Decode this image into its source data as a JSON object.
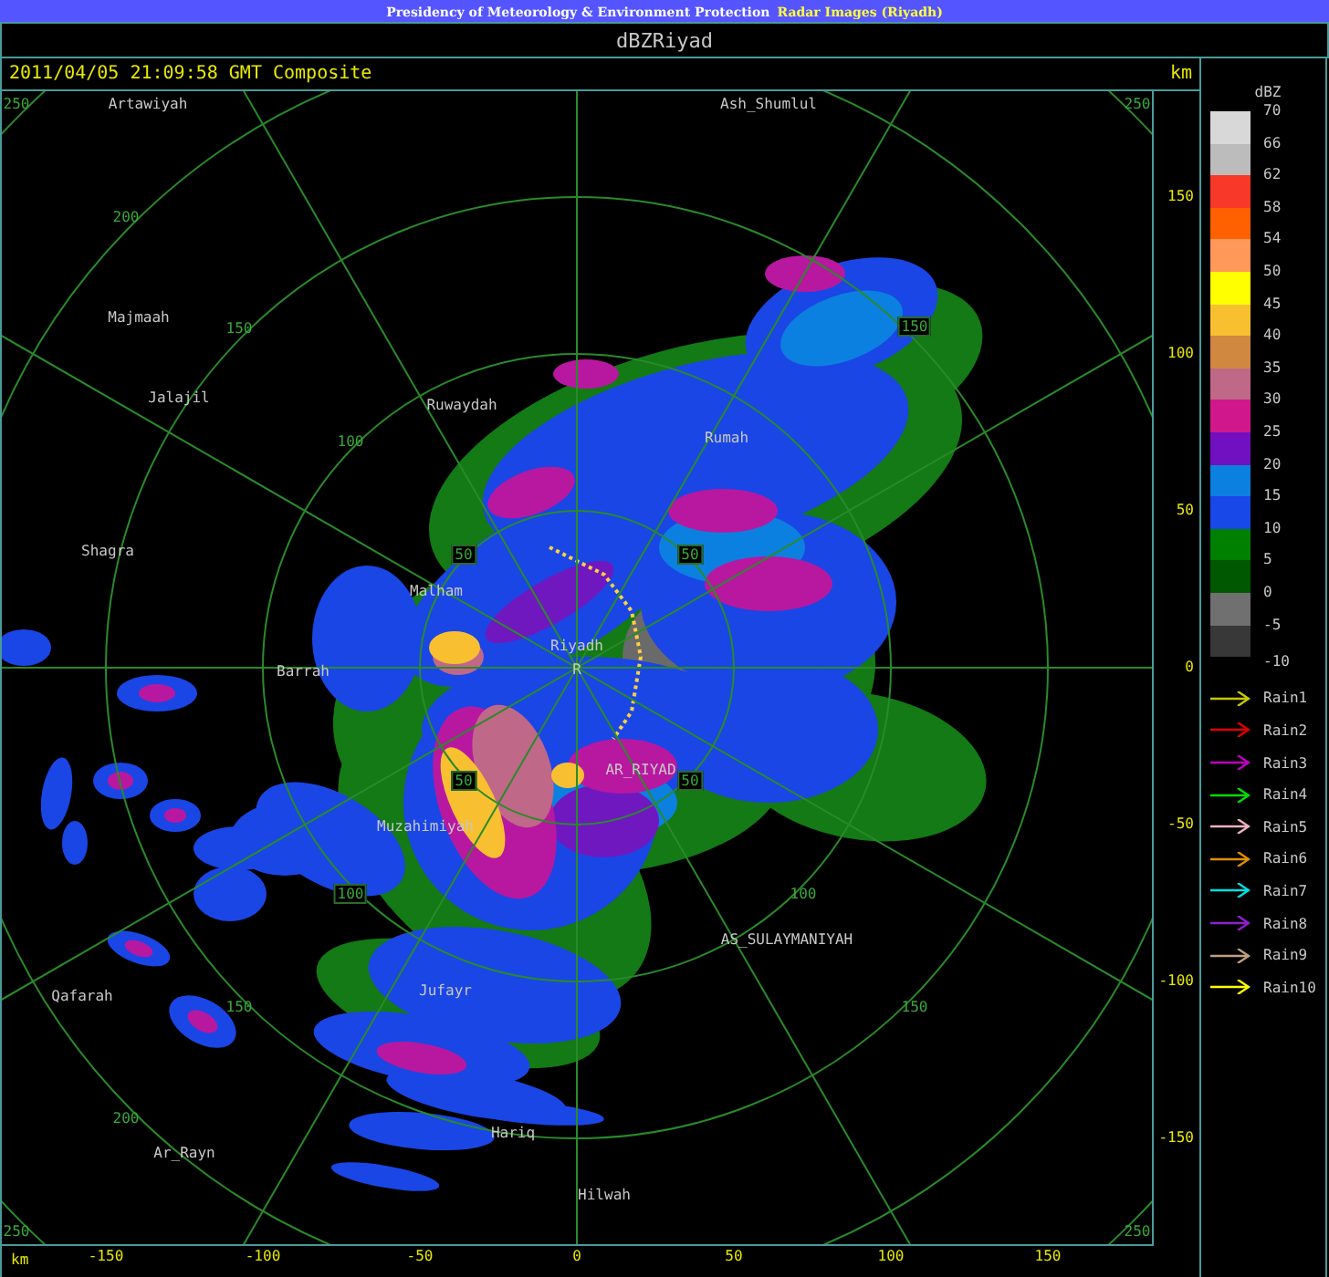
{
  "banner": {
    "text": "Presidency of Meteorology & Environment Protection",
    "highlight": "Radar Images (Riyadh)"
  },
  "title": "dBZRiyad",
  "info_bar": {
    "timestamp": "2011/04/05 21:09:58 GMT Composite",
    "unit": "km"
  },
  "map": {
    "place_names": [
      "Artawiyah",
      "Ash_Shumlul",
      "Majmaah",
      "Jalajil",
      "Shagra",
      "Ruwaydah",
      "Rumah",
      "Malham",
      "Barrah",
      "Riyadh",
      "R",
      "AR_RIYAD",
      "Muzahimiyah",
      "AS_SULAYMANIYAH",
      "Jufayr",
      "Qafarah",
      "Ar_Rayn",
      "Hariq",
      "Hilwah"
    ],
    "range_labels": [
      {
        "text": "250",
        "boxed": false
      },
      {
        "text": "250",
        "boxed": false
      },
      {
        "text": "200",
        "boxed": false
      },
      {
        "text": "150",
        "boxed": false
      },
      {
        "text": "150",
        "boxed": true
      },
      {
        "text": "100",
        "boxed": false
      },
      {
        "text": "50",
        "boxed": true
      },
      {
        "text": "50",
        "boxed": true
      },
      {
        "text": "50",
        "boxed": true
      },
      {
        "text": "50",
        "boxed": true
      },
      {
        "text": "100",
        "boxed": true
      },
      {
        "text": "100",
        "boxed": false
      },
      {
        "text": "150",
        "boxed": false
      },
      {
        "text": "150",
        "boxed": false
      },
      {
        "text": "200",
        "boxed": false
      },
      {
        "text": "250",
        "boxed": false
      },
      {
        "text": "250",
        "boxed": false
      }
    ]
  },
  "y_axis": {
    "ticks": [
      "150",
      "100",
      "50",
      "0",
      "-50",
      "-100",
      "-150"
    ]
  },
  "x_axis": {
    "unit": "km",
    "ticks": [
      "-150",
      "-100",
      "-50",
      "0",
      "50",
      "100",
      "150"
    ]
  },
  "legend": {
    "title": "dBZ",
    "scale": [
      {
        "label": "70",
        "color": "#d8d8d8"
      },
      {
        "label": "66",
        "color": "#bcbcbc"
      },
      {
        "label": "62",
        "color": "#f83828"
      },
      {
        "label": "58",
        "color": "#ff6000"
      },
      {
        "label": "54",
        "color": "#ff9858"
      },
      {
        "label": "50",
        "color": "#ffff00"
      },
      {
        "label": "45",
        "color": "#f8c030"
      },
      {
        "label": "40",
        "color": "#d08840"
      },
      {
        "label": "35",
        "color": "#c06888"
      },
      {
        "label": "30",
        "color": "#d0188c"
      },
      {
        "label": "25",
        "color": "#7010c0"
      },
      {
        "label": "20",
        "color": "#0c80e0"
      },
      {
        "label": "15",
        "color": "#1848e8"
      },
      {
        "label": "10",
        "color": "#008000"
      },
      {
        "label": "5",
        "color": "#005800"
      },
      {
        "label": "0",
        "color": "#707070"
      },
      {
        "label": "-5",
        "color": "#383838"
      }
    ],
    "bottom_label": "-10",
    "tracks": [
      {
        "label": "Rain1",
        "color": "#c8c800"
      },
      {
        "label": "Rain2",
        "color": "#e00000"
      },
      {
        "label": "Rain3",
        "color": "#c000c0"
      },
      {
        "label": "Rain4",
        "color": "#00e000"
      },
      {
        "label": "Rain5",
        "color": "#f0b0c0"
      },
      {
        "label": "Rain6",
        "color": "#e09000"
      },
      {
        "label": "Rain7",
        "color": "#00e0e0"
      },
      {
        "label": "Rain8",
        "color": "#9020d0"
      },
      {
        "label": "Rain9",
        "color": "#c0a080"
      },
      {
        "label": "Rain10",
        "color": "#ffff00"
      }
    ]
  }
}
